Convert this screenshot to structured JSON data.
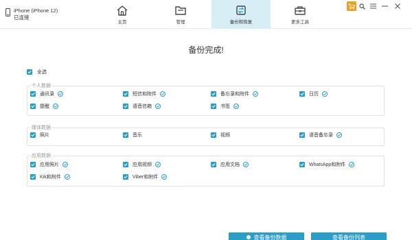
{
  "device": {
    "name": "iPhone (iPhone 12)",
    "status": "已连接"
  },
  "nav": [
    {
      "label": "主页",
      "icon": "home-icon"
    },
    {
      "label": "管理",
      "icon": "folder-icon"
    },
    {
      "label": "备份和恢复",
      "icon": "backup-restore-icon",
      "active": true
    },
    {
      "label": "更多工具",
      "icon": "toolbox-icon"
    }
  ],
  "window_controls": {
    "cart": "cart-icon",
    "search": "search-icon",
    "menu": "menu-icon",
    "minimize": "minimize-icon",
    "close": "close-icon"
  },
  "main": {
    "title": "备份完成!"
  },
  "select_all": {
    "label": "全选",
    "checked": true
  },
  "sections": {
    "personal": {
      "title": "个人数据",
      "items": [
        {
          "label": "通讯录",
          "checked": true,
          "info": true
        },
        {
          "label": "短信和附件",
          "checked": true,
          "info": true
        },
        {
          "label": "备忘录和附件",
          "checked": true,
          "info": true
        },
        {
          "label": "日历",
          "checked": true,
          "info": true
        },
        {
          "label": "提醒",
          "checked": true,
          "info": true
        },
        {
          "label": "语音信箱",
          "checked": true,
          "info": true
        },
        {
          "label": "书签",
          "checked": true,
          "info": true
        }
      ]
    },
    "media": {
      "title": "媒体数据",
      "items": [
        {
          "label": "照片",
          "checked": true,
          "info": false
        },
        {
          "label": "音乐",
          "checked": true,
          "info": false
        },
        {
          "label": "视频",
          "checked": true,
          "info": false
        },
        {
          "label": "语音备忘录",
          "checked": true,
          "info": true
        }
      ]
    },
    "app": {
      "title": "应用数据",
      "items": [
        {
          "label": "应用照片",
          "checked": true,
          "info": true
        },
        {
          "label": "应用视频",
          "checked": true,
          "info": true
        },
        {
          "label": "应用文档",
          "checked": true,
          "info": true
        },
        {
          "label": "WhatsApp和附件",
          "checked": true,
          "info": true
        },
        {
          "label": "Kik和附件",
          "checked": true,
          "info": true
        },
        {
          "label": "Viber和附件",
          "checked": true,
          "info": true
        }
      ]
    }
  },
  "buttons": {
    "view_backup": "查看备份数据",
    "view_list": "查看备份列表"
  },
  "colors": {
    "accent": "#2b9dc9",
    "active_tab": "#d7eef7",
    "cart": "#f0a020"
  }
}
